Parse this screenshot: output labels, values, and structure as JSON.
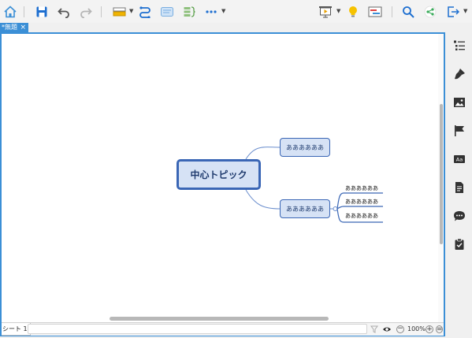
{
  "toolbar": {
    "items": [
      "home-icon",
      "save-icon",
      "undo-icon",
      "redo-icon",
      "format-painter-icon",
      "relationship-icon",
      "boundary-icon",
      "summary-icon",
      "more-icon",
      "presentation-icon",
      "idea-icon",
      "gantt-icon",
      "search-icon",
      "share-icon",
      "export-icon"
    ]
  },
  "tab": {
    "title": "*無題",
    "close": "×"
  },
  "mindmap": {
    "central": "中心トピック",
    "main_topics": [
      "ああああああ",
      "ああああああ"
    ],
    "subtopics": [
      "ああああああ",
      "ああああああ",
      "ああああああ"
    ]
  },
  "status": {
    "sheet": "シート 1",
    "zoom": "100%",
    "minus": "−",
    "plus": "+",
    "fit": "="
  },
  "sidebar": {
    "items": [
      "outline-icon",
      "style-icon",
      "image-icon",
      "marker-icon",
      "text-format-icon",
      "notes-icon",
      "comment-icon",
      "task-icon"
    ]
  },
  "colors": {
    "accent": "#3b8fd6",
    "topic_border": "#3a66b5",
    "topic_fill": "#d6e2f5"
  }
}
